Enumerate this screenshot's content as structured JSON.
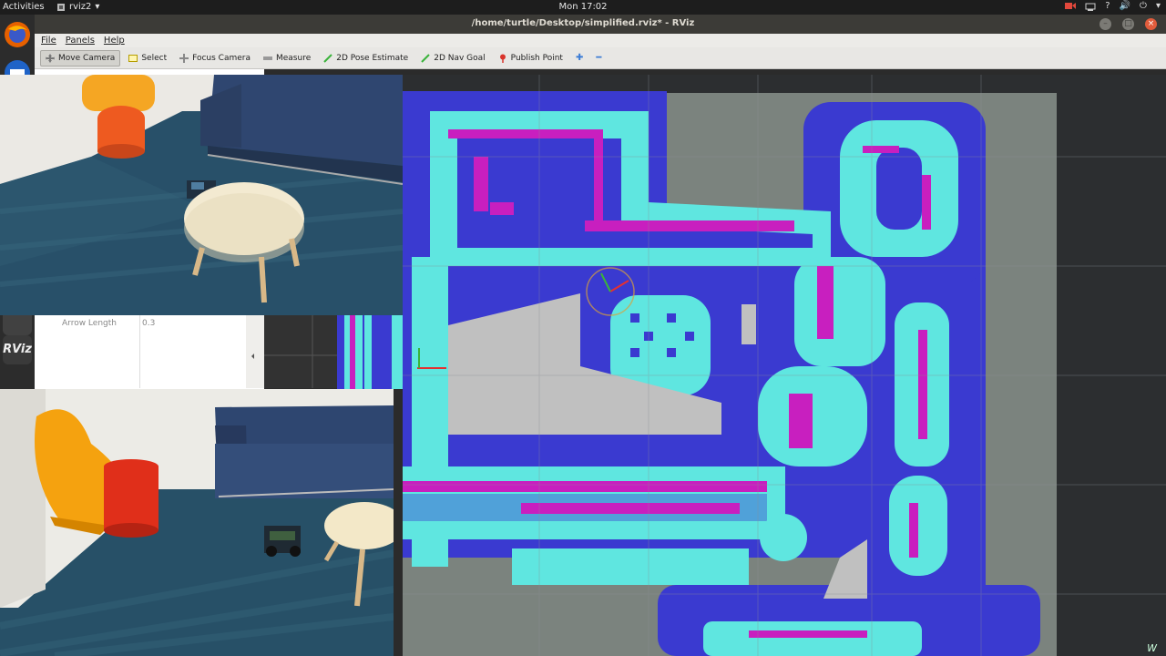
{
  "topbar": {
    "activities": "Activities",
    "app_menu": "rviz2",
    "app_menu_arrow": "▾",
    "clock": "Mon 17:02",
    "tray": [
      "?",
      "🔊",
      "⏻",
      "▾"
    ]
  },
  "window": {
    "title": "/home/turtle/Desktop/simplified.rviz* - RViz",
    "controls": [
      "–",
      "□",
      "×"
    ]
  },
  "menubar": {
    "file": "File",
    "panels": "Panels",
    "help": "Help"
  },
  "toolbar": {
    "move_camera": "Move Camera",
    "select": "Select",
    "focus_camera": "Focus Camera",
    "measure": "Measure",
    "pose_estimate": "2D Pose Estimate",
    "nav_goal": "2D Nav Goal",
    "publish_point": "Publish Point",
    "plus": "✚",
    "minus": "━"
  },
  "properties": {
    "arrow_length_key": "Arrow Length",
    "arrow_length_value": "0.3"
  },
  "dock": {
    "rviz_label": "RViz"
  },
  "colors": {
    "map_free": "#3a3ad0",
    "inflation": "#5fe6e0",
    "lethal": "#c81fbf",
    "unknown": "#7b837e",
    "free_gray": "#c0c0c0"
  },
  "watermark": "W"
}
